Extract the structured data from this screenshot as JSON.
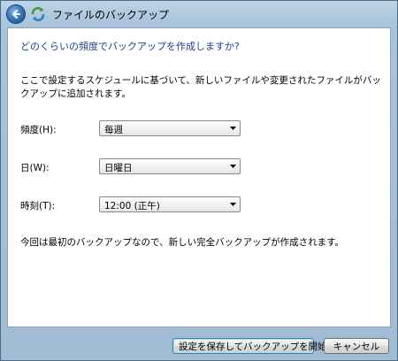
{
  "window": {
    "title": "ファイルのバックアップ"
  },
  "main": {
    "heading": "どのくらいの頻度でバックアップを作成しますか?",
    "description": "ここで設定するスケジュールに基づいて、新しいファイルや変更されたファイルがバックアップに追加されます。",
    "frequency": {
      "label": "頻度(H):",
      "value": "毎週"
    },
    "day": {
      "label": "日(W):",
      "value": "日曜日"
    },
    "time": {
      "label": "時刻(T):",
      "value": "12:00 (正午)"
    },
    "note": "今回は最初のバックアップなので、新しい完全バックアップが作成されます。"
  },
  "buttons": {
    "save_start": "設定を保存してバックアップを開始(S)",
    "cancel": "キャンセル"
  },
  "icons": {
    "back": "back-arrow-icon",
    "app": "backup-app-icon",
    "dropdown": "dropdown-arrow-icon"
  },
  "colors": {
    "heading": "#1e3f8a",
    "frame": "#a9c4da",
    "default_button_border": "#3c7fb1"
  }
}
